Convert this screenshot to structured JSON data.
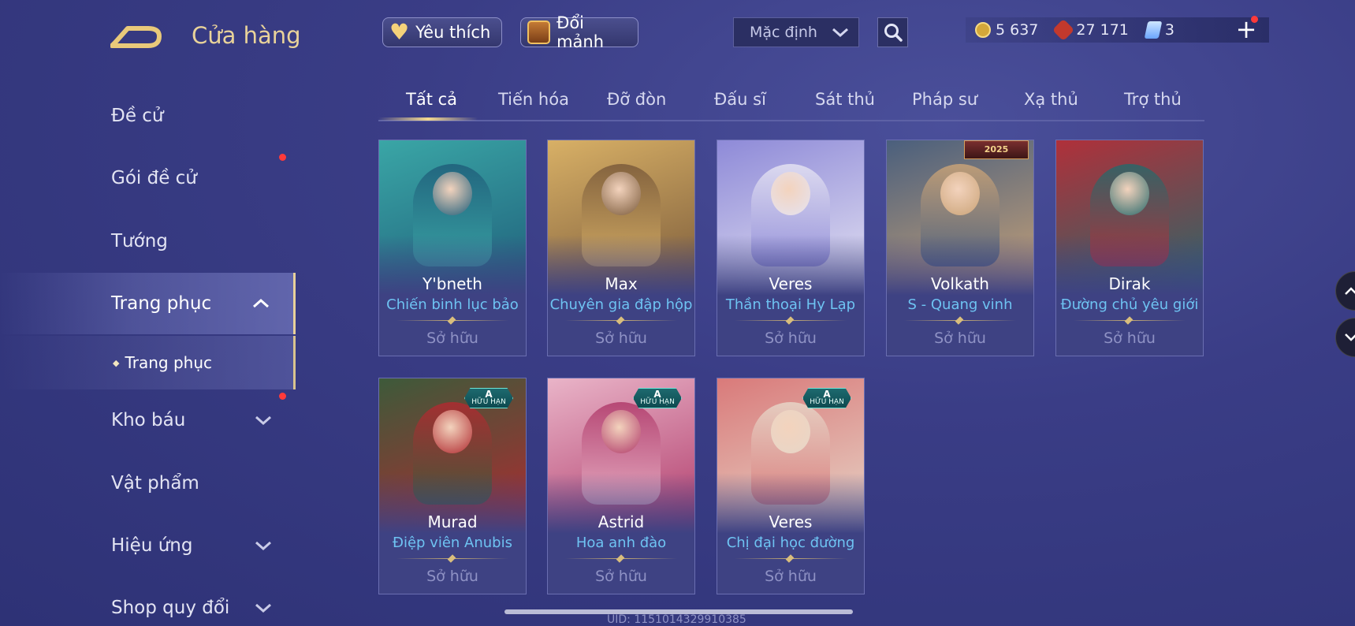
{
  "header": {
    "title": "Cửa hàng",
    "favorites_label": "Yêu thích",
    "fragments_label": "Đổi mảnh",
    "sort_value": "Mặc định"
  },
  "currency": {
    "gold": "5 637",
    "vouchers": "27 171",
    "gems": "3"
  },
  "sidebar": {
    "items": [
      {
        "label": "Đề cử"
      },
      {
        "label": "Gói đề cử"
      },
      {
        "label": "Tướng"
      },
      {
        "label": "Trang phục"
      },
      {
        "label": "Trang phục"
      },
      {
        "label": "Kho báu"
      },
      {
        "label": "Vật phẩm"
      },
      {
        "label": "Hiệu ứng"
      },
      {
        "label": "Shop quy đổi"
      }
    ]
  },
  "tabs": [
    "Tất cả",
    "Tiến hóa",
    "Đỡ đòn",
    "Đấu sĩ",
    "Sát thủ",
    "Pháp sư",
    "Xạ thủ",
    "Trợ thủ"
  ],
  "cards": [
    {
      "hero": "Y'bneth",
      "skin": "Chiến binh lục bảo",
      "status": "Sở hữu",
      "art_colors": [
        "#3aa6a6",
        "#1f5e7a"
      ]
    },
    {
      "hero": "Max",
      "skin": "Chuyên gia đập hộp",
      "status": "Sở hữu",
      "art_colors": [
        "#d8b066",
        "#7a5a3a"
      ]
    },
    {
      "hero": "Veres",
      "skin": "Thần thoại Hy Lạp",
      "status": "Sở hữu",
      "art_colors": [
        "#8e8ad8",
        "#e5e3f2"
      ]
    },
    {
      "hero": "Volkath",
      "skin": "S - Quang vinh",
      "status": "Sở hữu",
      "art_colors": [
        "#4a5f7d",
        "#caa377"
      ],
      "ribbon": "2025"
    },
    {
      "hero": "Dirak",
      "skin": "Đường chủ yêu giới",
      "status": "Sở hữu",
      "art_colors": [
        "#b0303a",
        "#28686a"
      ]
    },
    {
      "hero": "Murad",
      "skin": "Điệp viên Anubis",
      "status": "Sở hữu",
      "art_colors": [
        "#3d5a3a",
        "#b02a30"
      ],
      "badge_grade": "A",
      "badge_text": "HỮU HẠN"
    },
    {
      "hero": "Astrid",
      "skin": "Hoa anh đào",
      "status": "Sở hữu",
      "art_colors": [
        "#e9b4c8",
        "#b03a6a"
      ],
      "badge_grade": "A",
      "badge_text": "HỮU HẠN"
    },
    {
      "hero": "Veres",
      "skin": "Chị đại học đường",
      "status": "Sở hữu",
      "art_colors": [
        "#d97a7a",
        "#e7d6c8"
      ],
      "badge_grade": "A",
      "badge_text": "HỮU HẠN"
    }
  ],
  "uid_text": "UID: 1151014329910385",
  "colors": {
    "accent_gold": "#e9d39a",
    "skin_name_blue": "#6ec3f2",
    "notification_red": "#ff3a3a"
  }
}
